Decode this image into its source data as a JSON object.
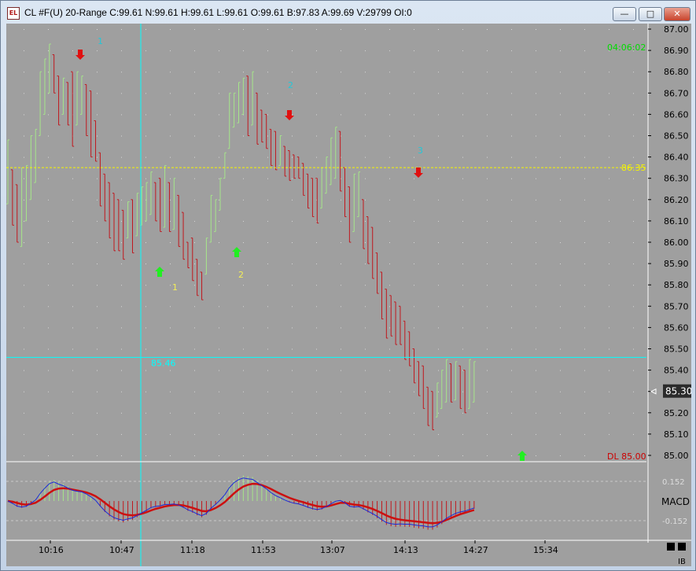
{
  "window": {
    "title": "CL #F(U) 20-Range C:99.61 N:99.61 H:99.61 L:99.61 O:99.61 B:97.83 A:99.69 V:29799 OI:0",
    "app_icon": "chart-app-icon",
    "controls": [
      "minimize-icon",
      "maximize-icon",
      "close-icon"
    ]
  },
  "chart": {
    "clock": "04:06:02",
    "hline_label": "86.35",
    "cursor_label": "85.46",
    "last_price": "85.30",
    "dl_label": "DL 85.00",
    "macd_label": "MACD",
    "macd_pos": "0.152",
    "macd_neg": "-0.152",
    "corner_label": "IB",
    "markers": {
      "cyan": [
        "1",
        "2",
        "3"
      ],
      "yellow": [
        "1",
        "2"
      ]
    },
    "colors": {
      "background": "#9f9f9f",
      "up_bar": "#a6e68a",
      "down_bar": "#c0181e",
      "hline": "#f5f500",
      "cursor": "#00ffff",
      "clock": "#00dd00",
      "dl": "#cc0000"
    }
  },
  "chart_data": {
    "type": "candlestick",
    "y_ticks": [
      "87.00",
      "86.90",
      "86.80",
      "86.70",
      "86.60",
      "86.50",
      "86.40",
      "86.30",
      "86.20",
      "86.10",
      "86.00",
      "85.90",
      "85.80",
      "85.70",
      "85.60",
      "85.50",
      "85.40",
      "85.30",
      "85.20",
      "85.10",
      "85.00"
    ],
    "ylim": [
      85.0,
      87.0
    ],
    "x_ticks": [
      "10:16",
      "10:47",
      "11:18",
      "11:53",
      "13:07",
      "14:13",
      "14:27",
      "15:34"
    ],
    "horizontal_level": 86.35,
    "cursor_level": 85.46,
    "last": 85.3,
    "range_bars": [
      [
        86.18,
        86.48
      ],
      [
        86.08,
        86.34
      ],
      [
        86.0,
        86.27
      ],
      [
        85.98,
        86.35
      ],
      [
        86.1,
        86.36
      ],
      [
        86.2,
        86.5
      ],
      [
        86.28,
        86.53
      ],
      [
        86.5,
        86.8
      ],
      [
        86.6,
        86.86
      ],
      [
        86.7,
        86.93
      ],
      [
        86.7,
        86.88
      ],
      [
        86.55,
        86.78
      ],
      [
        86.6,
        86.77
      ],
      [
        86.55,
        86.75
      ],
      [
        86.45,
        86.8
      ],
      [
        86.55,
        86.8
      ],
      [
        86.6,
        86.78
      ],
      [
        86.5,
        86.74
      ],
      [
        86.4,
        86.71
      ],
      [
        86.38,
        86.57
      ],
      [
        86.17,
        86.42
      ],
      [
        86.1,
        86.32
      ],
      [
        86.02,
        86.28
      ],
      [
        85.96,
        86.23
      ],
      [
        85.96,
        86.2
      ],
      [
        85.92,
        86.15
      ],
      [
        86.02,
        86.19
      ],
      [
        85.95,
        86.2
      ],
      [
        86.03,
        86.23
      ],
      [
        86.08,
        86.26
      ],
      [
        86.1,
        86.28
      ],
      [
        86.13,
        86.33
      ],
      [
        86.1,
        86.28
      ],
      [
        86.05,
        86.3
      ],
      [
        86.07,
        86.36
      ],
      [
        86.05,
        86.28
      ],
      [
        86.06,
        86.3
      ],
      [
        85.98,
        86.22
      ],
      [
        85.92,
        86.14
      ],
      [
        85.88,
        86.0
      ],
      [
        85.82,
        86.02
      ],
      [
        85.75,
        85.92
      ],
      [
        85.73,
        85.86
      ],
      [
        85.85,
        86.02
      ],
      [
        86.0,
        86.22
      ],
      [
        86.05,
        86.2
      ],
      [
        86.15,
        86.3
      ],
      [
        86.3,
        86.42
      ],
      [
        86.44,
        86.7
      ],
      [
        86.54,
        86.7
      ],
      [
        86.56,
        86.75
      ],
      [
        86.6,
        86.77
      ],
      [
        86.5,
        86.78
      ],
      [
        86.55,
        86.8
      ],
      [
        86.46,
        86.7
      ],
      [
        86.47,
        86.62
      ],
      [
        86.44,
        86.6
      ],
      [
        86.36,
        86.53
      ],
      [
        86.34,
        86.52
      ],
      [
        86.36,
        86.5
      ],
      [
        86.31,
        86.45
      ],
      [
        86.29,
        86.43
      ],
      [
        86.3,
        86.41
      ],
      [
        86.3,
        86.4
      ],
      [
        86.22,
        86.37
      ],
      [
        86.16,
        86.32
      ],
      [
        86.12,
        86.3
      ],
      [
        86.09,
        86.3
      ],
      [
        86.16,
        86.35
      ],
      [
        86.23,
        86.4
      ],
      [
        86.27,
        86.49
      ],
      [
        86.3,
        86.54
      ],
      [
        86.24,
        86.52
      ],
      [
        86.12,
        86.35
      ],
      [
        86.0,
        86.26
      ],
      [
        86.05,
        86.32
      ],
      [
        86.12,
        86.33
      ],
      [
        85.97,
        86.2
      ],
      [
        85.9,
        86.12
      ],
      [
        85.83,
        86.07
      ],
      [
        85.76,
        85.95
      ],
      [
        85.64,
        85.86
      ],
      [
        85.55,
        85.78
      ],
      [
        85.56,
        85.75
      ],
      [
        85.52,
        85.72
      ],
      [
        85.52,
        85.7
      ],
      [
        85.45,
        85.63
      ],
      [
        85.42,
        85.58
      ],
      [
        85.34,
        85.5
      ],
      [
        85.28,
        85.44
      ],
      [
        85.22,
        85.42
      ],
      [
        85.14,
        85.32
      ],
      [
        85.12,
        85.3
      ],
      [
        85.18,
        85.34
      ],
      [
        85.22,
        85.4
      ],
      [
        85.25,
        85.45
      ],
      [
        85.25,
        85.43
      ],
      [
        85.26,
        85.44
      ],
      [
        85.22,
        85.42
      ],
      [
        85.2,
        85.4
      ],
      [
        85.22,
        85.45
      ],
      [
        85.25,
        85.44
      ]
    ],
    "macd_levels": [
      0.152,
      -0.152
    ]
  }
}
